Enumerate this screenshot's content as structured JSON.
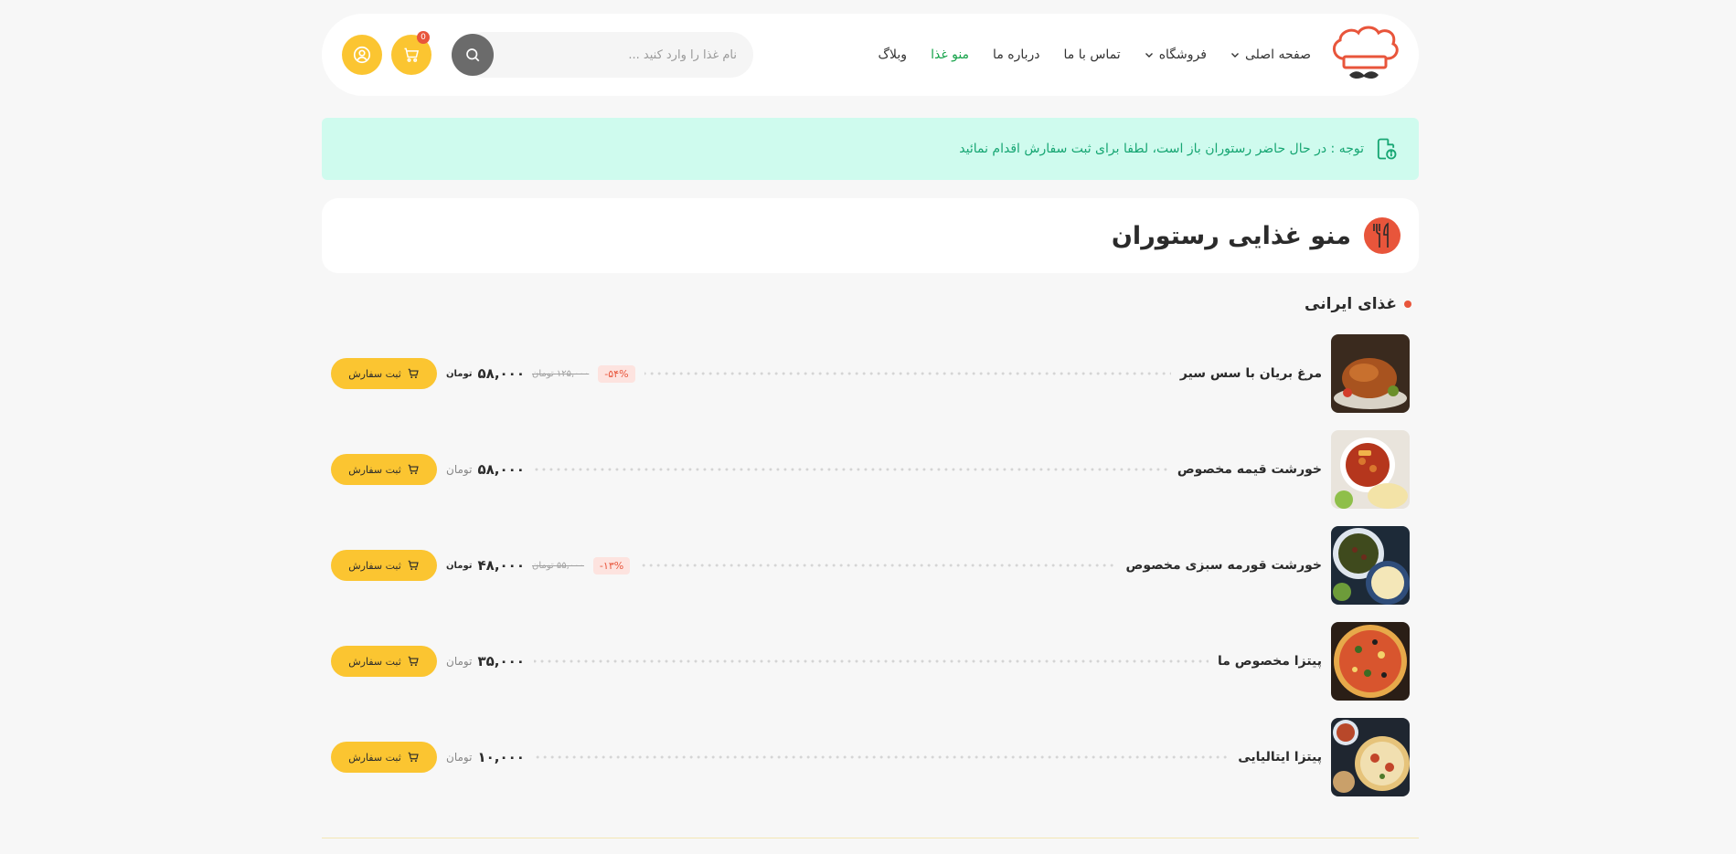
{
  "header": {
    "nav": [
      {
        "label": "صفحه اصلی",
        "has_dropdown": true,
        "active": false
      },
      {
        "label": "فروشگاه",
        "has_dropdown": true,
        "active": false
      },
      {
        "label": "تماس با ما",
        "has_dropdown": false,
        "active": false
      },
      {
        "label": "درباره ما",
        "has_dropdown": false,
        "active": false
      },
      {
        "label": "منو غذا",
        "has_dropdown": false,
        "active": true
      },
      {
        "label": "وبلاگ",
        "has_dropdown": false,
        "active": false
      }
    ],
    "search_placeholder": "نام غذا را وارد کنید ...",
    "cart_count": "0"
  },
  "notice": {
    "text": "توجه : در حال حاضر رستوران باز است، لطفا برای ثبت سفارش اقدام نمائید"
  },
  "page": {
    "title": "منو غذایی رستوران"
  },
  "category": {
    "title": "غذای ایرانی"
  },
  "menu_items": [
    {
      "name": "مرغ بریان با سس سیر",
      "discount": "۵۴%-",
      "old_price": "۱۲۵,۰۰۰ تومان",
      "price": "۵۸,۰۰۰",
      "unit": "تومان",
      "order_label": "ثبت سفارش",
      "image": "roast-chicken"
    },
    {
      "name": "خورشت قیمه مخصوص",
      "discount": "",
      "old_price": "",
      "price": "۵۸,۰۰۰",
      "unit": "تومان",
      "order_label": "ثبت سفارش",
      "image": "gheymeh-stew"
    },
    {
      "name": "خورشت قورمه سبزی مخصوص",
      "discount": "۱۳%-",
      "old_price": "۵۵,۰۰۰ تومان",
      "price": "۴۸,۰۰۰",
      "unit": "تومان",
      "order_label": "ثبت سفارش",
      "image": "ghormeh-sabzi"
    },
    {
      "name": "پیتزا مخصوص ما",
      "discount": "",
      "old_price": "",
      "price": "۳۵,۰۰۰",
      "unit": "تومان",
      "order_label": "ثبت سفارش",
      "image": "special-pizza"
    },
    {
      "name": "پیتزا ایتالیایی",
      "discount": "",
      "old_price": "",
      "price": "۱۰,۰۰۰",
      "unit": "تومان",
      "order_label": "ثبت سفارش",
      "image": "italian-pizza"
    }
  ],
  "colors": {
    "accent_yellow": "#fbc531",
    "accent_red": "#e8553b",
    "active_green": "#16a34a",
    "notice_bg": "#cffbee",
    "notice_text": "#17a673"
  }
}
